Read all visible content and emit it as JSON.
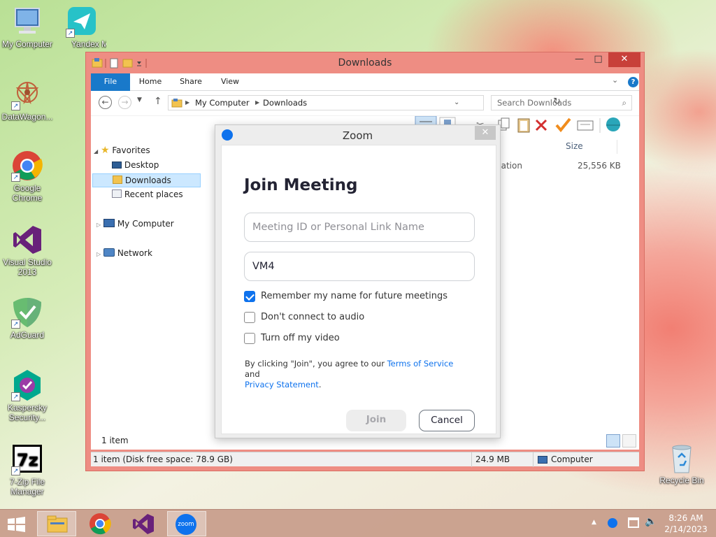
{
  "desktop": {
    "icons": [
      {
        "label": "My Computer"
      },
      {
        "label": "Yandex Messe..."
      },
      {
        "label": "DataWagon..."
      },
      {
        "label": "Google Chrome"
      },
      {
        "label": "Visual Studio 2013"
      },
      {
        "label": "AdGuard"
      },
      {
        "label": "Kaspersky Security..."
      },
      {
        "label": "7-Zip File Manager"
      }
    ],
    "recycle_bin": "Recycle Bin"
  },
  "explorer": {
    "title": "Downloads",
    "tabs": [
      "File",
      "Home",
      "Share",
      "View"
    ],
    "address": [
      "My Computer",
      "Downloads"
    ],
    "search_placeholder": "Search Downloads",
    "nav": {
      "favorites": "Favorites",
      "desktop": "Desktop",
      "downloads": "Downloads",
      "recent": "Recent places",
      "my_computer": "My Computer",
      "network": "Network"
    },
    "columns": {
      "size": "Size"
    },
    "file_row": {
      "type_fragment": "cation",
      "size": "25,556 KB"
    },
    "item_count": "1 item",
    "status": {
      "left": "1 item (Disk free space: 78.9 GB)",
      "size": "24.9 MB",
      "location": "Computer"
    }
  },
  "zoom": {
    "title": "Zoom",
    "heading": "Join Meeting",
    "meeting_id_placeholder": "Meeting ID or Personal Link Name",
    "name_value": "VM4",
    "options": [
      {
        "label": "Remember my name for future meetings",
        "checked": true
      },
      {
        "label": "Don't connect to audio",
        "checked": false
      },
      {
        "label": "Turn off my video",
        "checked": false
      }
    ],
    "legal": {
      "prefix": "By clicking \"Join\", you agree to our",
      "tos": "Terms of Service",
      "and": "and",
      "privacy": "Privacy Statement",
      "period": "."
    },
    "join_label": "Join",
    "cancel_label": "Cancel"
  },
  "taskbar": {
    "zoom_label": "zoom",
    "time": "8:26 AM",
    "date": "2/14/2023"
  }
}
